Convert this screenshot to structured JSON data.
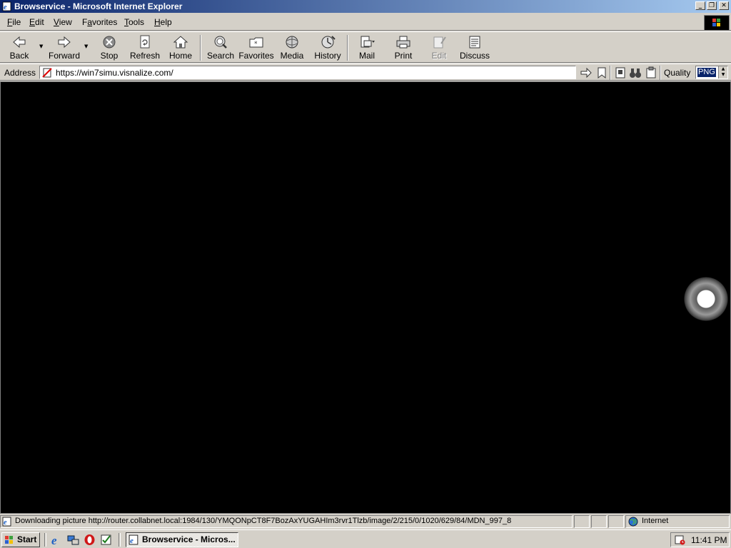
{
  "window": {
    "title": "Browservice - Microsoft Internet Explorer"
  },
  "menu": [
    {
      "label": "File",
      "key": "F",
      "rest": "ile"
    },
    {
      "label": "Edit",
      "key": "E",
      "rest": "dit"
    },
    {
      "label": "View",
      "key": "V",
      "rest": "iew"
    },
    {
      "label": "Favorites",
      "key": "a",
      "pre": "F",
      "rest": "vorites"
    },
    {
      "label": "Tools",
      "key": "T",
      "rest": "ools"
    },
    {
      "label": "Help",
      "key": "H",
      "rest": "elp"
    }
  ],
  "toolbar": {
    "back": "Back",
    "forward": "Forward",
    "stop": "Stop",
    "refresh": "Refresh",
    "home": "Home",
    "search": "Search",
    "favorites": "Favorites",
    "media": "Media",
    "history": "History",
    "mail": "Mail",
    "print": "Print",
    "edit": "Edit",
    "discuss": "Discuss"
  },
  "address": {
    "label": "Address",
    "url": "https://win7simu.visnalize.com/",
    "quality_label": "Quality",
    "quality_value": "PNG"
  },
  "status": {
    "text": "Downloading picture http://router.collabnet.local:1984/130/YMQONpCT8F7BozAxYUGAHIm3rvr1Tlzb/image/2/215/0/1020/629/84/MDN_997_8",
    "zone": "Internet"
  },
  "taskbar": {
    "start": "Start",
    "task": "Browservice - Micros...",
    "clock": "11:41 PM"
  },
  "colors": {
    "titlebar_start": "#0a246a",
    "titlebar_end": "#a6caf0",
    "face": "#d4d0c8",
    "viewport": "#000000"
  }
}
